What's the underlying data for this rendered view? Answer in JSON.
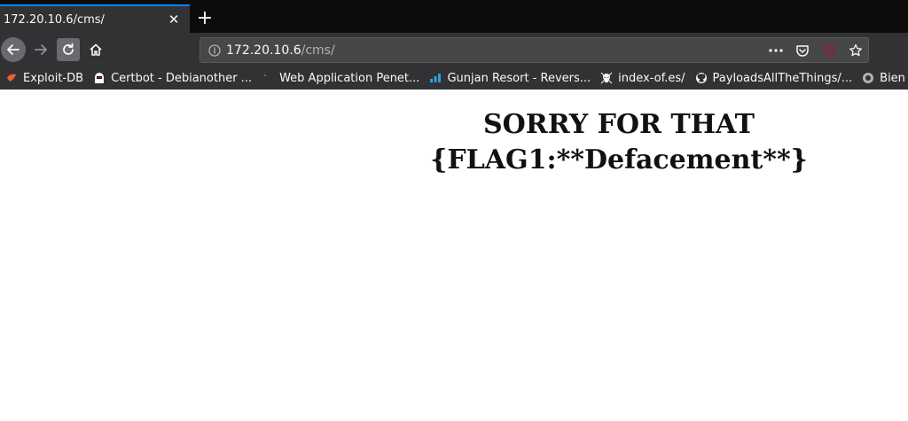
{
  "tab": {
    "title": "172.20.10.6/cms/",
    "close": "✕"
  },
  "new_tab": "+",
  "url": {
    "host": "172.20.10.6",
    "path": "/cms/"
  },
  "bookmarks": [
    {
      "label": "Exploit-DB",
      "icon": "exploit-db-icon"
    },
    {
      "label": "Certbot - Debianother ...",
      "icon": "certbot-icon"
    },
    {
      "label": "Web Application Penet...",
      "icon": "page-icon"
    },
    {
      "label": "Gunjan Resort - Revers...",
      "icon": "bar-chart-icon"
    },
    {
      "label": "index-of.es/",
      "icon": "skull-icon"
    },
    {
      "label": "PayloadsAllTheThings/...",
      "icon": "github-icon"
    },
    {
      "label": "Bien",
      "icon": "bookmark-icon"
    }
  ],
  "content": {
    "line1": "SORRY FOR THAT",
    "line2": "{FLAG1:**Defacement**}"
  },
  "colors": {
    "accent": "#0a84ff",
    "toolbar": "#323234",
    "tabstrip": "#0c0c0d"
  }
}
